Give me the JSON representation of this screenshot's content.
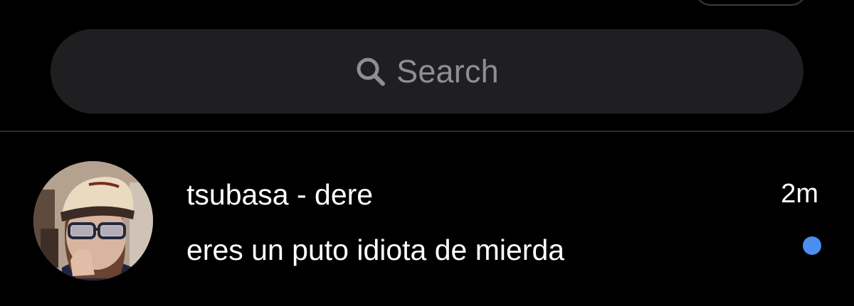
{
  "search": {
    "placeholder": "Search",
    "icon": "search-icon"
  },
  "conversations": [
    {
      "name": "tsubasa - dere",
      "preview": "eres un puto idiota de mierda",
      "time": "2m",
      "unread": true,
      "avatar_icon": "avatar-photo"
    }
  ],
  "colors": {
    "background": "#000000",
    "search_bg": "#1f1f21",
    "placeholder": "#8e8e93",
    "divider": "#2c2c2e",
    "unread_dot": "#4a8ff0"
  }
}
